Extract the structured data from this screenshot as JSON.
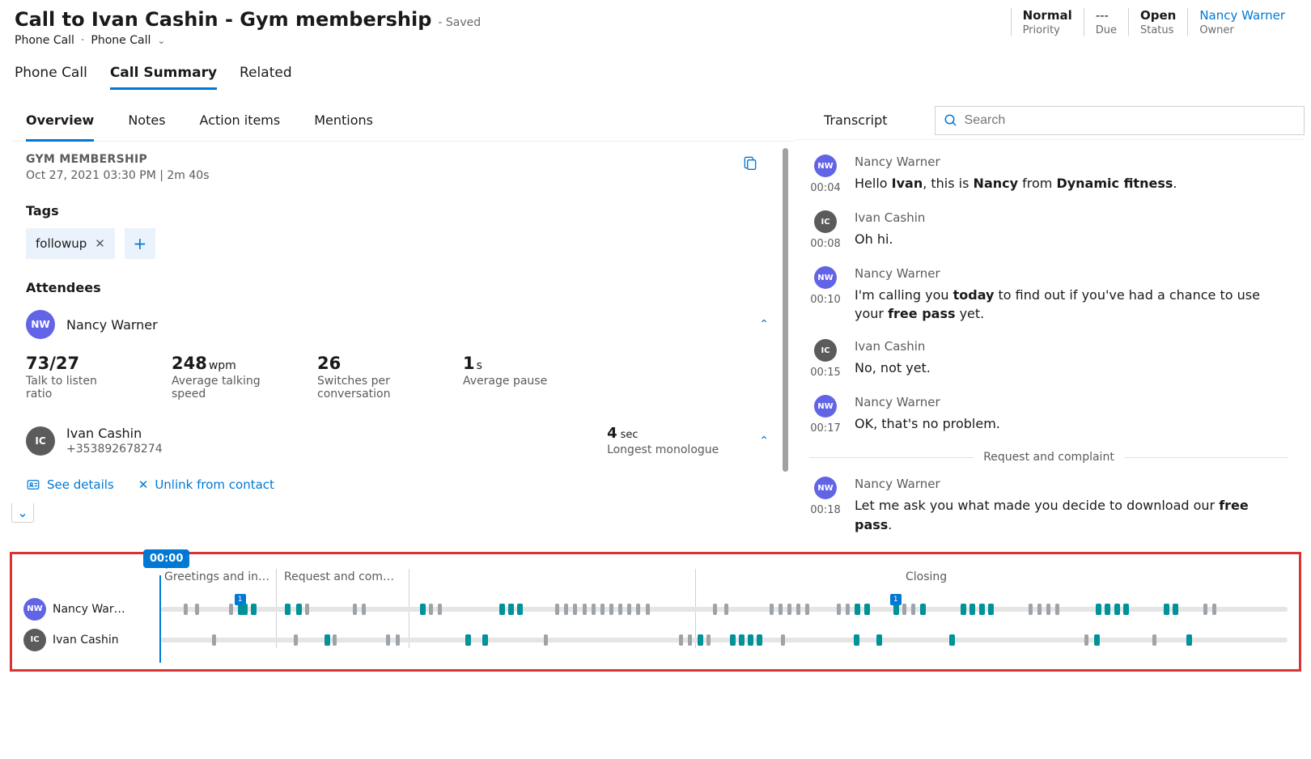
{
  "header": {
    "title": "Call to Ivan Cashin - Gym membership",
    "savedState": "- Saved",
    "subtitle": {
      "type": "Phone Call",
      "channel": "Phone Call"
    },
    "meta": {
      "priority": {
        "value": "Normal",
        "label": "Priority"
      },
      "due": {
        "value": "---",
        "label": "Due"
      },
      "status": {
        "value": "Open",
        "label": "Status"
      },
      "owner": {
        "value": "Nancy Warner",
        "label": "Owner"
      }
    }
  },
  "mainTabs": {
    "t1": "Phone Call",
    "t2": "Call Summary",
    "t3": "Related"
  },
  "subTabs": {
    "t1": "Overview",
    "t2": "Notes",
    "t3": "Action items",
    "t4": "Mentions"
  },
  "overview": {
    "heading": "GYM MEMBERSHIP",
    "dateLine": "Oct 27, 2021 03:30 PM  |  2m 40s",
    "tagsTitle": "Tags",
    "tag1": "followup",
    "attendeesTitle": "Attendees",
    "nancy": {
      "initials": "NW",
      "name": "Nancy Warner"
    },
    "stats": {
      "ratio": {
        "v": "73/27",
        "l": "Talk to listen ratio"
      },
      "wpm": {
        "v": "248",
        "u": "wpm",
        "l": "Average talking speed"
      },
      "switch": {
        "v": "26",
        "l": "Switches per conversation"
      },
      "pause": {
        "v": "1",
        "u": "s",
        "l": "Average pause"
      }
    },
    "ivan": {
      "initials": "IC",
      "name": "Ivan Cashin",
      "phone": "+353892678274",
      "monoV": "4",
      "monoU": "sec",
      "monoL": "Longest monologue"
    },
    "links": {
      "details": "See details",
      "unlink": "Unlink from contact"
    }
  },
  "transcriptHead": {
    "tab": "Transcript",
    "searchPlaceholder": "Search"
  },
  "transcript": {
    "m1": {
      "sp": "Nancy Warner",
      "t": "00:04",
      "txt": "Hello <b>Ivan</b>, this is <b>Nancy</b> from <b>Dynamic fitness</b>."
    },
    "m2": {
      "sp": "Ivan Cashin",
      "t": "00:08",
      "txt": "Oh hi."
    },
    "m3": {
      "sp": "Nancy Warner",
      "t": "00:10",
      "txt": "I'm calling you <b>today</b> to find out if you've had a chance to use your <b>free pass</b> yet."
    },
    "m4": {
      "sp": "Ivan Cashin",
      "t": "00:15",
      "txt": "No, not yet."
    },
    "m5": {
      "sp": "Nancy Warner",
      "t": "00:17",
      "txt": "OK, that's no problem."
    },
    "divider1": "Request and complaint",
    "m6": {
      "sp": "Nancy Warner",
      "t": "00:18",
      "txt": "Let me ask you what made you decide to download our <b>free pass</b>."
    }
  },
  "timeline": {
    "badge": "00:00",
    "sections": {
      "s1": "Greetings and in…",
      "s2": "Request and com…",
      "s3": "Closing"
    },
    "rows": {
      "r1": "Nancy War…",
      "r2": "Ivan Cashin"
    },
    "miniBadge": "1"
  }
}
